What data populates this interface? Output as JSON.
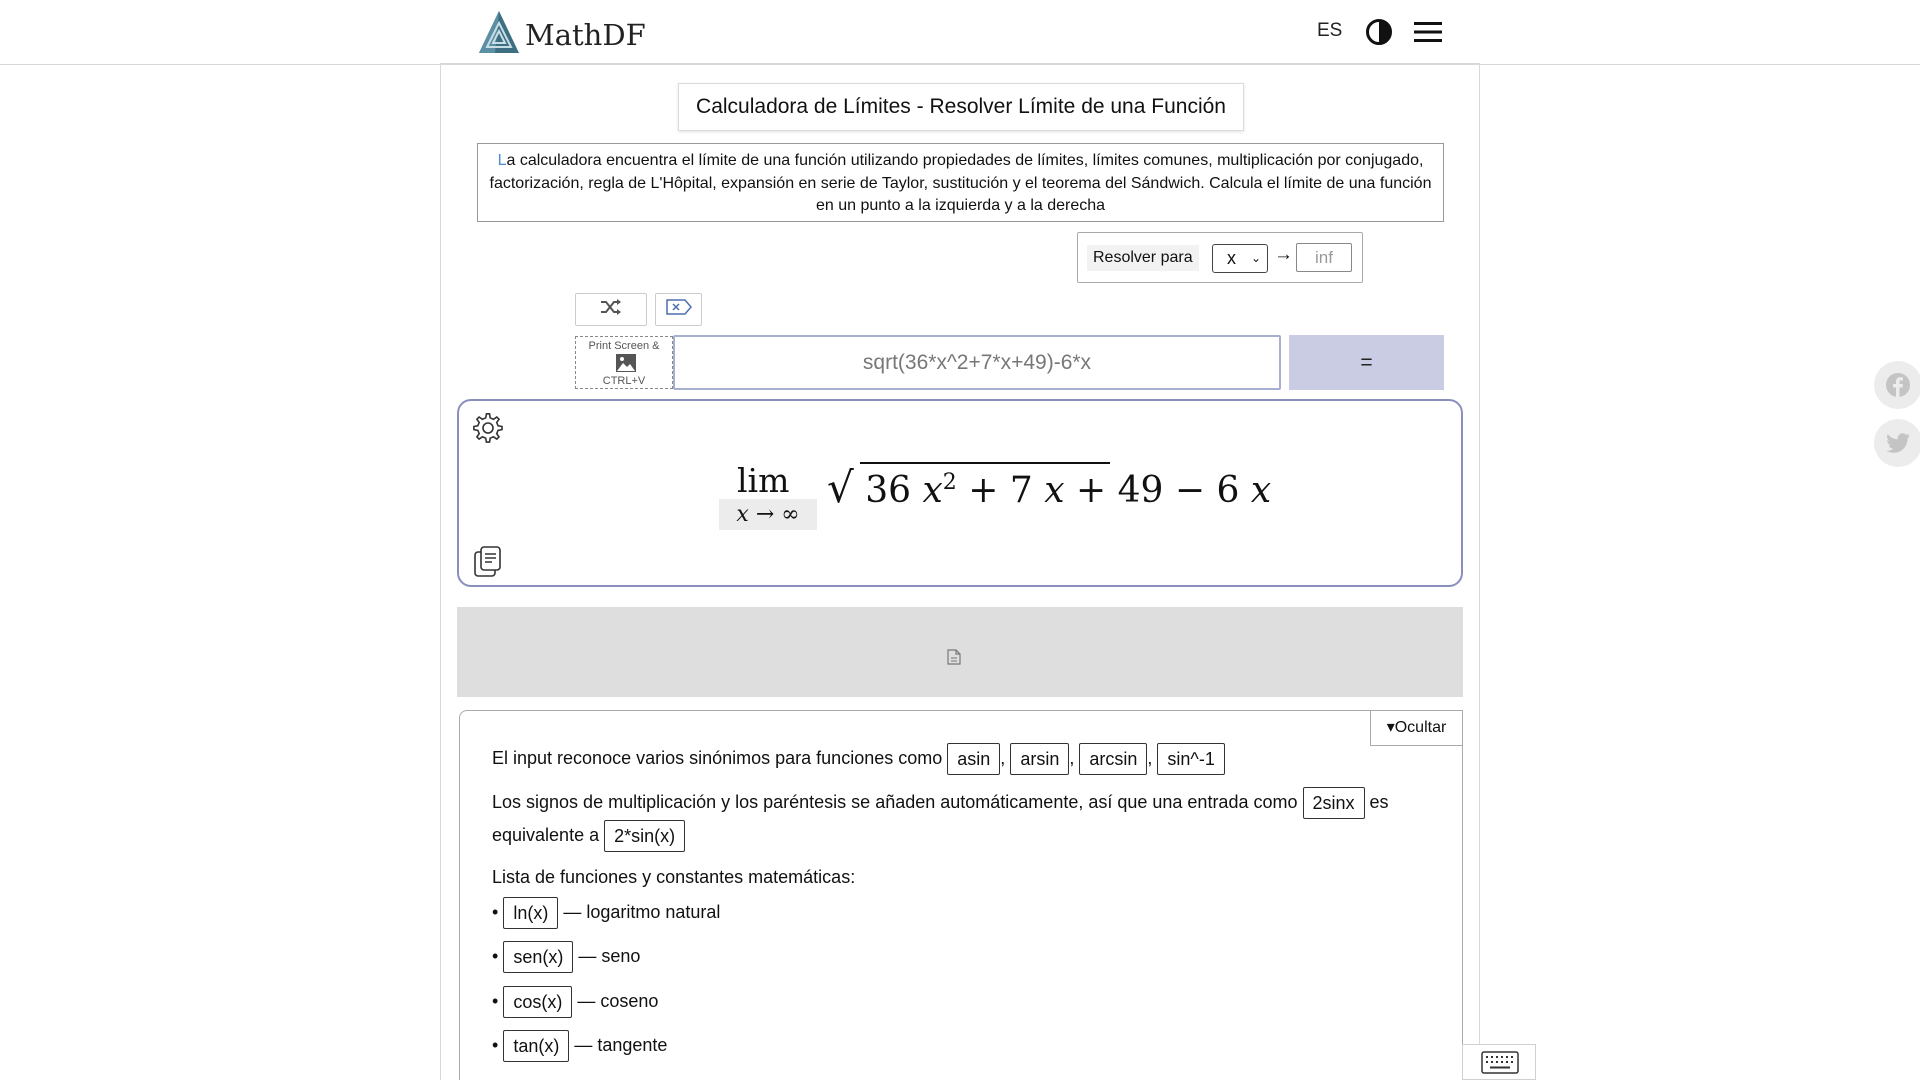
{
  "header": {
    "brand": "MathDF",
    "lang": "ES"
  },
  "title": "Calculadora de Límites - Resolver Límite de una Función",
  "description": {
    "first_letter": "L",
    "rest": "a calculadora encuentra el límite de una función utilizando propiedades de límites, límites comunes, multiplicación por conjugado, factorización, regla de L'Hôpital, expansión en serie de Taylor, sustitución y el teorema del Sándwich. Calcula el límite de una función en un punto a la izquierda y a la derecha"
  },
  "solve": {
    "label": "Resolver para",
    "variable": "x",
    "arrow": "→",
    "point_placeholder": "inf"
  },
  "paste": {
    "line1": "Print Screen &",
    "line2": "CTRL+V"
  },
  "input": {
    "placeholder": "sqrt(36*x^2+7*x+49)-6*x",
    "equals": "="
  },
  "preview": {
    "lim": "lim",
    "sub_var": "x",
    "sub_arrow": "→",
    "sub_point": "∞",
    "sqrt": "√",
    "coef": "36",
    "var": "x",
    "exp": "2",
    "plus1": "+",
    "coef2": "7",
    "plus2": "+",
    "const": "49",
    "minus": "−",
    "coef3": "6"
  },
  "help": {
    "hide": "▾Ocultar",
    "synonyms_text": "El input reconoce varios sinónimos para funciones como",
    "synonyms": [
      "asin",
      "arsin",
      "arcsin",
      "sin^-1"
    ],
    "comma": ",",
    "mult_text1": "Los signos de multiplicación y los paréntesis se añaden automáticamente, así que una entrada como",
    "mult_chip1": "2sinx",
    "mult_text2": "es",
    "mult_text3": "equivalente a",
    "mult_chip2": "2*sin(x)",
    "list_title": "Lista de funciones y constantes matemáticas:",
    "bullet": "•",
    "functions": [
      {
        "fn": "ln(x)",
        "desc": "— logaritmo natural"
      },
      {
        "fn": "sen(x)",
        "desc": "— seno"
      },
      {
        "fn": "cos(x)",
        "desc": "— coseno"
      },
      {
        "fn": "tan(x)",
        "desc": "— tangente"
      }
    ]
  },
  "icons": {
    "logo": "mathdf-logo-icon",
    "theme": "contrast-icon",
    "menu": "hamburger-menu-icon",
    "shuffle": "shuffle-icon",
    "clear": "clear-input-icon",
    "image": "image-icon",
    "settings": "gear-icon",
    "copy": "copy-icon",
    "ad": "document-icon",
    "facebook": "facebook-icon",
    "twitter": "twitter-icon",
    "keyboard": "keyboard-icon"
  },
  "colors": {
    "accent_border": "#8a8fbe",
    "equals_bg": "#c9cce2",
    "first_letter": "#4b8cd2"
  }
}
